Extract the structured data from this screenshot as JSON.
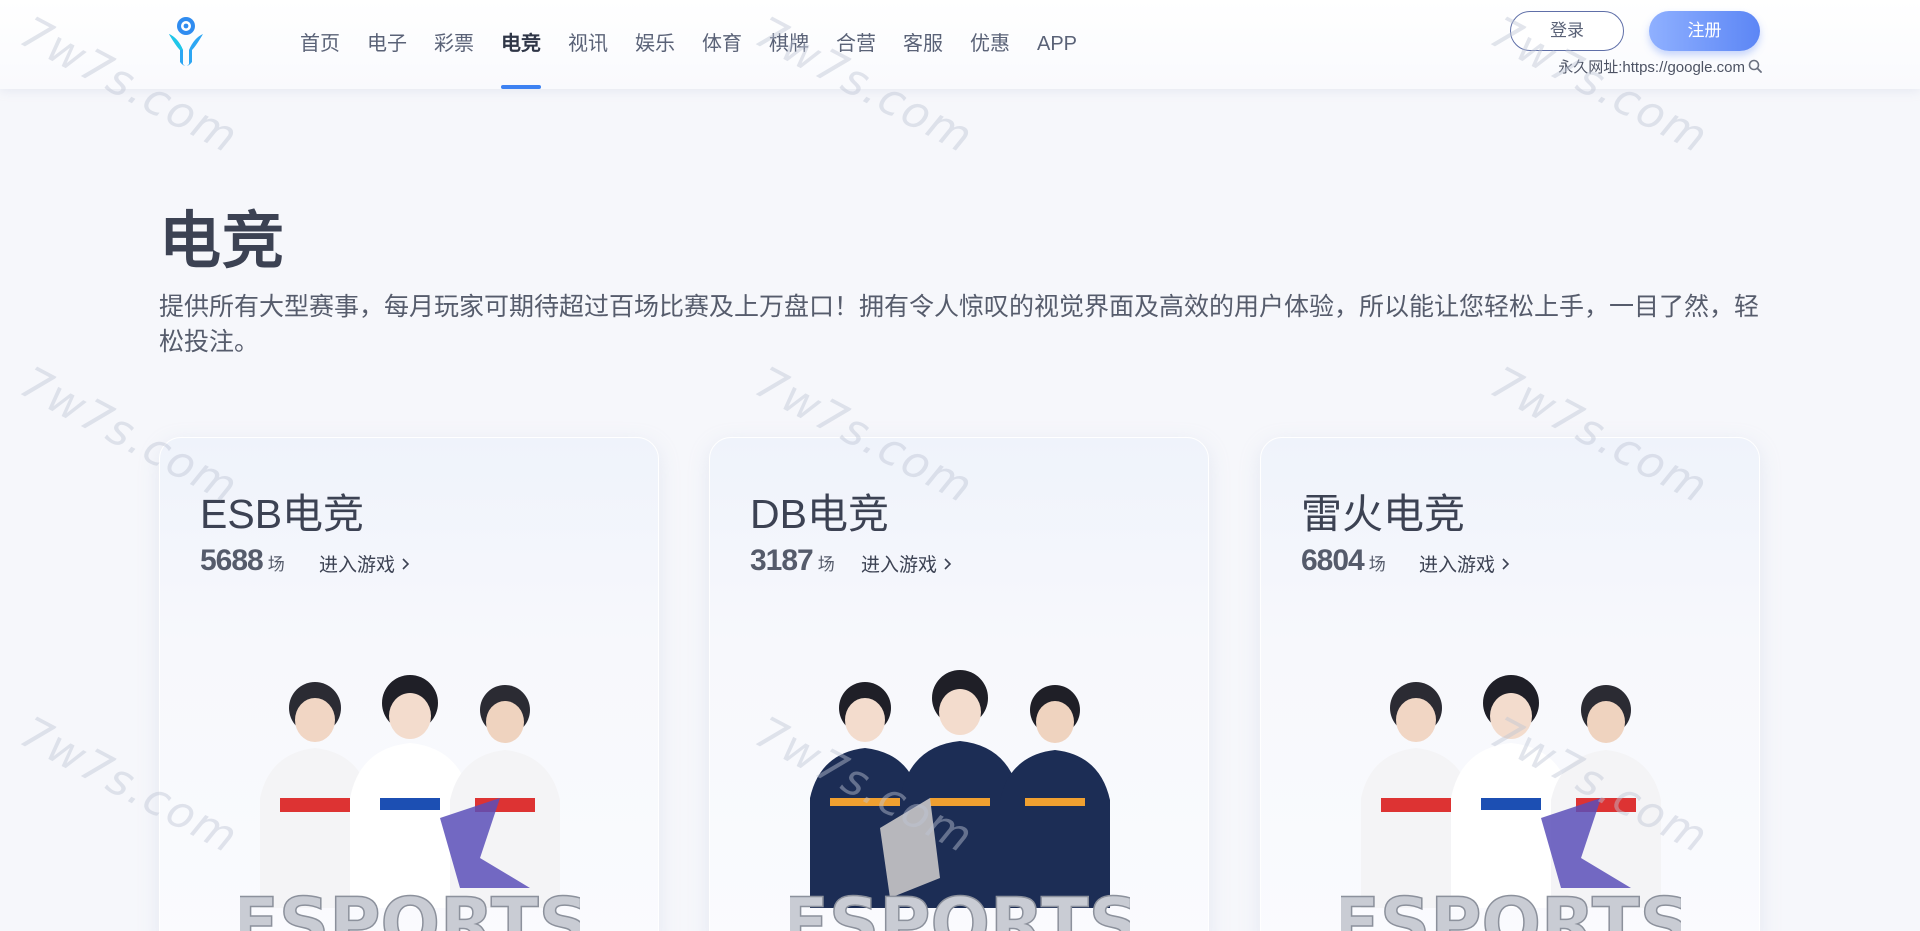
{
  "header": {
    "nav": [
      "首页",
      "电子",
      "彩票",
      "电竞",
      "视讯",
      "娱乐",
      "体育",
      "棋牌",
      "合营",
      "客服",
      "优惠",
      "APP"
    ],
    "active_nav": "电竞",
    "login_label": "登录",
    "register_label": "注册",
    "permalink_label": "永久网址:https://google.com"
  },
  "main": {
    "title": "电竞",
    "description": "提供所有大型赛事，每月玩家可期待超过百场比赛及上万盘口！拥有令人惊叹的视觉界面及高效的用户体验，所以能让您轻松上手，一目了然，轻松投注。",
    "cards": [
      {
        "title": "ESB电竞",
        "count": "5688",
        "unit": "场",
        "enter_label": "进入游戏",
        "art_text": "ESPORTS"
      },
      {
        "title": "DB电竞",
        "count": "3187",
        "unit": "场",
        "enter_label": "进入游戏",
        "art_text": "ESPORTS"
      },
      {
        "title": "雷火电竞",
        "count": "6804",
        "unit": "场",
        "enter_label": "进入游戏",
        "art_text": "ESPORTS"
      }
    ]
  },
  "watermark": "7w7s.com",
  "colors": {
    "accent": "#3d82f2",
    "register_gradient_start": "#8fb0ff",
    "register_gradient_end": "#5c86f5"
  },
  "icons": {
    "logo": "brand-logo",
    "search": "search-icon",
    "chevron": "chevron-right-icon"
  }
}
